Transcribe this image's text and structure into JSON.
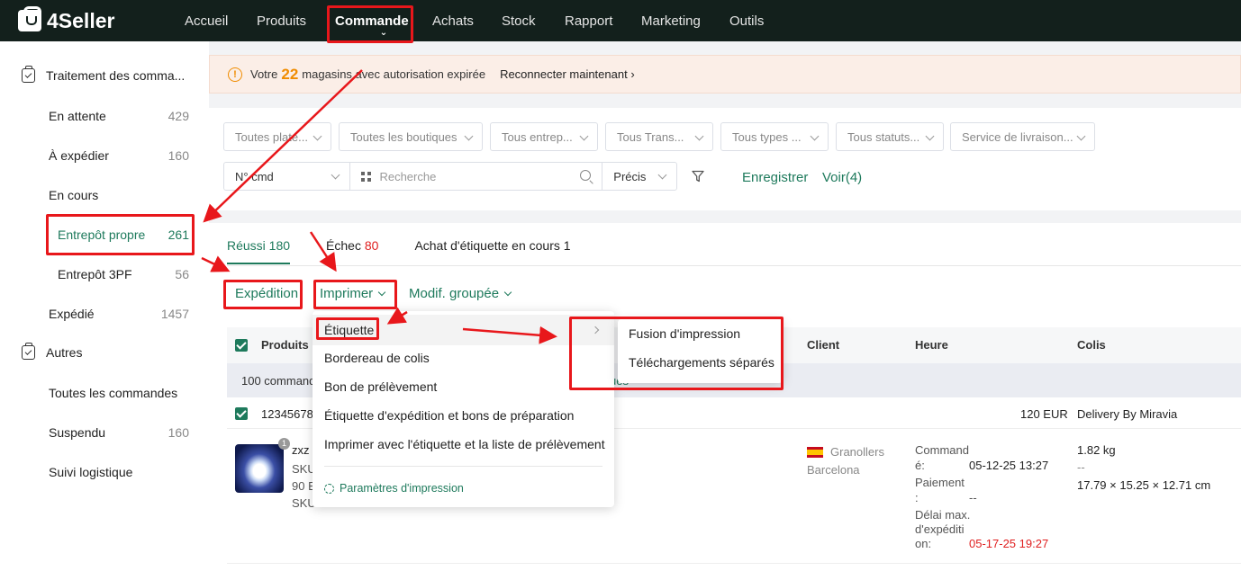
{
  "brand": {
    "name": "4Seller"
  },
  "nav": {
    "items": [
      {
        "label": "Accueil"
      },
      {
        "label": "Produits"
      },
      {
        "label": "Commande"
      },
      {
        "label": "Achats"
      },
      {
        "label": "Stock"
      },
      {
        "label": "Rapport"
      },
      {
        "label": "Marketing"
      },
      {
        "label": "Outils"
      }
    ],
    "active_chevron": "⌄"
  },
  "sidebar": {
    "group1": "Traitement des comma...",
    "items": [
      {
        "label": "En attente",
        "count": "429"
      },
      {
        "label": "À expédier",
        "count": "160"
      },
      {
        "label": "En cours",
        "count": ""
      },
      {
        "label": "Entrepôt propre",
        "count": "261"
      },
      {
        "label": "Entrepôt 3PF",
        "count": "56"
      },
      {
        "label": "Expédié",
        "count": "1457"
      }
    ],
    "group2": "Autres",
    "items2": [
      {
        "label": "Toutes les commandes",
        "count": ""
      },
      {
        "label": "Suspendu",
        "count": "160"
      },
      {
        "label": "Suivi logistique",
        "count": ""
      }
    ]
  },
  "notice": {
    "prefix": "Votre",
    "number": "22",
    "suffix": "magasins avec autorisation expirée",
    "link": "Reconnecter maintenant",
    "link_arrow": "›",
    "icon_glyph": "!"
  },
  "filters": {
    "selects": [
      "Toutes plate...",
      "Toutes les boutiques",
      "Tous entrep...",
      "Tous Trans...",
      "Tous types ...",
      "Tous statuts...",
      "Service de livraison..."
    ],
    "search_type": "N° cmd",
    "search_placeholder": "Recherche",
    "match": "Précis",
    "save": "Enregistrer",
    "view": "Voir(4)"
  },
  "tabs": [
    {
      "label": "Réussi 180",
      "count": ""
    },
    {
      "label": "Échec",
      "count": "80"
    },
    {
      "label": "Achat d'étiquette en cours 1",
      "count": ""
    }
  ],
  "actions": {
    "shipping": "Expédition",
    "print": "Imprimer",
    "bulk_edit": "Modif. groupée"
  },
  "table": {
    "headers": {
      "products": "Produits",
      "client": "Client",
      "time": "Heure",
      "package": "Colis"
    },
    "count_bar": "100 command",
    "count_bar_tail": "ues",
    "order_row": {
      "order_no": "12345678",
      "amount": "120 EUR",
      "carrier": "Delivery By Miravia"
    },
    "item": {
      "qty_badge": "1",
      "name": "zxz",
      "sku_line1": "SKU",
      "line2": "90 E",
      "sku_line3": "SKU",
      "city": "Granollers",
      "region": "Barcelona",
      "order_label_1": "Command",
      "order_label_2": "é:",
      "order_time": "05-12-25 13:27",
      "pay_label_1": "Paiement",
      "pay_label_2": ":",
      "pay_value": "--",
      "deadline_label_1": "Délai max.",
      "deadline_label_2": "d'expéditi",
      "deadline_label_3": "on:",
      "deadline_value": "05-17-25 19:27",
      "weight": "1.82 kg",
      "dash": "--",
      "dims": "17.79 × 15.25 × 12.71 cm"
    }
  },
  "print_menu": {
    "items": [
      "Étiquette",
      "Bordereau de colis",
      "Bon de prélèvement",
      "Étiquette d'expédition et bons de préparation",
      "Imprimer avec l'étiquette et la liste de prélèvement"
    ],
    "settings": "Paramètres d'impression"
  },
  "submenu": {
    "items": [
      "Fusion d'impression",
      "Téléchargements séparés"
    ]
  },
  "colors": {
    "accent": "#1e7a5c",
    "annotation": "#e8171b",
    "topbar": "#13201c"
  }
}
